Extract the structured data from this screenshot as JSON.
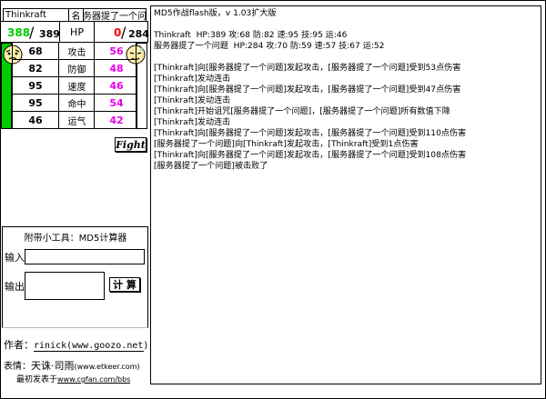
{
  "left_panel": {
    "player1_name": "Thinkraft",
    "name_label": "名",
    "player2_name": "服务器提了一个问题",
    "p1_hp_current": "388",
    "p1_hp_max": "389",
    "hp_label": "HP",
    "p2_hp_current": "0",
    "p2_hp_max": "284",
    "stats": [
      {
        "label": "攻击",
        "p1": "68",
        "p2": "56"
      },
      {
        "label": "防御",
        "p1": "82",
        "p2": "48"
      },
      {
        "label": "速度",
        "p1": "95",
        "p2": "46"
      },
      {
        "label": "命中",
        "p1": "95",
        "p2": "54"
      },
      {
        "label": "运气",
        "p1": "46",
        "p2": "42"
      }
    ],
    "p1_hp_fraction": 0.997,
    "p2_hp_fraction": 0.0,
    "fight_label": "Fight"
  },
  "tool": {
    "title": "附带小工具：MD5计算器",
    "input_label": "输入",
    "output_label": "输出",
    "input_value": "",
    "output_value": "",
    "calc_button": "计 算"
  },
  "credits": {
    "author_label": "作者：",
    "author_value": "rinick(www.goozo.net)",
    "emote_label": "表情：",
    "emote_value": "天诛·司雨",
    "emote_link": "(www.etkeer.com)",
    "first_pub_label": "最初发表于",
    "first_pub_link": "www.cgfan.com/bbs"
  },
  "log": {
    "lines": [
      "MD5作战flash版，v 1.03扩大版",
      "",
      "Thinkraft  HP:389 攻:68 防:82 速:95 技:95 运:46",
      "服务器提了一个问题  HP:284 攻:70 防:59 速:57 技:67 运:52",
      "",
      "[Thinkraft]向[服务器提了一个问题]发起攻击，[服务器提了一个问题]受到53点伤害",
      "[Thinkraft]发动连击",
      "[Thinkraft]向[服务器提了一个问题]发起攻击，[服务器提了一个问题]受到47点伤害",
      "[Thinkraft]发动连击",
      "[Thinkraft]开始诅咒[服务器提了一个问题]，[服务器提了一个问题]所有数值下降",
      "[Thinkraft]发动连击",
      "[Thinkraft]向[服务器提了一个问题]发起攻击，[服务器提了一个问题]受到110点伤害",
      "[服务器提了一个问题]向[Thinkraft]发起攻击，[Thinkraft]受到1点伤害",
      "[Thinkraft]向[服务器提了一个问题]发起攻击，[服务器提了一个问题]受到108点伤害",
      "[服务器提了一个问题]被击败了"
    ]
  },
  "colors": {
    "green": "#00cc00",
    "red": "#ff0000",
    "pink": "#e800e8",
    "accent_dark": "#000000"
  }
}
